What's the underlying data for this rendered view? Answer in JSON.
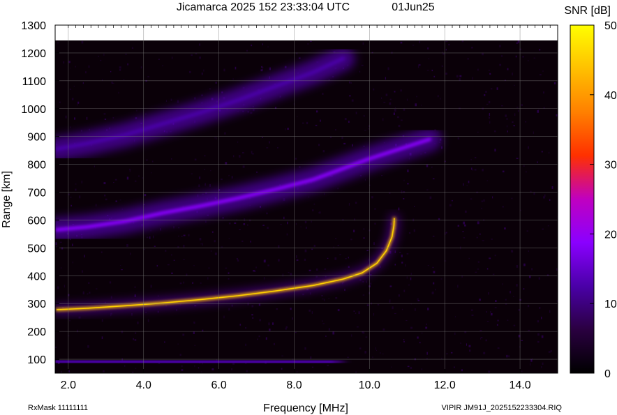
{
  "header": {
    "title": "Jicamarca 2025 152 23:33:04 UTC",
    "date": "01Jun25"
  },
  "footer": {
    "left": "RxMask 11111111",
    "right": "VIPIR  JM91J_2025152233304.RIQ"
  },
  "chart_data": {
    "type": "heatmap",
    "title": "Jicamarca 2025 152 23:33:04 UTC",
    "xlabel": "Frequency [MHz]",
    "ylabel": "Range [km]",
    "xlim": [
      1.65,
      15.0
    ],
    "ylim": [
      50,
      1300
    ],
    "x_ticks": [
      {
        "value": 2.0,
        "label": "2.0"
      },
      {
        "value": 4.0,
        "label": "4.0"
      },
      {
        "value": 6.0,
        "label": "6.0"
      },
      {
        "value": 8.0,
        "label": "8.0"
      },
      {
        "value": 10.0,
        "label": "10.0"
      },
      {
        "value": 12.0,
        "label": "12.0"
      },
      {
        "value": 14.0,
        "label": "14.0"
      }
    ],
    "y_ticks": [
      {
        "value": 100,
        "label": "100"
      },
      {
        "value": 200,
        "label": "200"
      },
      {
        "value": 300,
        "label": "300"
      },
      {
        "value": 400,
        "label": "400"
      },
      {
        "value": 500,
        "label": "500"
      },
      {
        "value": 600,
        "label": "600"
      },
      {
        "value": 700,
        "label": "700"
      },
      {
        "value": 800,
        "label": "800"
      },
      {
        "value": 900,
        "label": "900"
      },
      {
        "value": 1000,
        "label": "1000"
      },
      {
        "value": 1100,
        "label": "1100"
      },
      {
        "value": 1200,
        "label": "1200"
      },
      {
        "value": 1300,
        "label": "1300"
      }
    ],
    "colorbar": {
      "label": "SNR [dB]",
      "min": 0,
      "max": 50,
      "ticks": [
        {
          "value": 0,
          "label": "0"
        },
        {
          "value": 10,
          "label": "10"
        },
        {
          "value": 20,
          "label": "20"
        },
        {
          "value": 30,
          "label": "30"
        },
        {
          "value": 40,
          "label": "40"
        },
        {
          "value": 50,
          "label": "50"
        }
      ],
      "colors": [
        "#000000",
        "#2a0040",
        "#4a00a8",
        "#8a00ff",
        "#c000c0",
        "#ff3000",
        "#ff8000",
        "#ffc000",
        "#ffff00"
      ]
    },
    "grid": true,
    "traces": [
      {
        "freq": [
          1.7,
          2.5,
          3.5,
          4.5,
          5.5,
          6.5,
          7.5,
          8.5,
          9.3,
          9.8,
          10.2,
          10.45,
          10.6,
          10.65,
          10.66
        ],
        "range": [
          278,
          283,
          292,
          302,
          314,
          328,
          345,
          365,
          388,
          410,
          445,
          490,
          540,
          580,
          605
        ],
        "snr": 42
      },
      {
        "freq": [
          1.7,
          2.5,
          3.5,
          4.5,
          5.5,
          6.5,
          7.5,
          8.5,
          9.3,
          10.0,
          10.8,
          11.6
        ],
        "range": [
          565,
          575,
          595,
          625,
          650,
          678,
          710,
          745,
          785,
          820,
          855,
          890
        ],
        "snr": 18
      },
      {
        "freq": [
          1.7,
          2.5,
          3.5,
          4.5,
          5.5,
          6.5,
          7.5,
          8.5,
          9.3
        ],
        "range": [
          855,
          875,
          905,
          945,
          985,
          1030,
          1080,
          1130,
          1180
        ],
        "snr": 12
      },
      {
        "freq": [
          1.7,
          3.0,
          4.5,
          6.0,
          7.5,
          9.0
        ],
        "range": [
          95,
          92,
          90,
          88,
          88,
          88
        ],
        "snr": 14
      }
    ]
  }
}
